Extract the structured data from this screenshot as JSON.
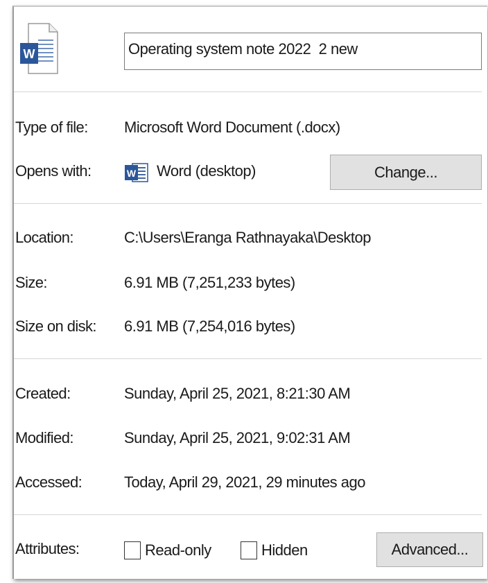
{
  "header": {
    "file_icon": "word-document-icon",
    "file_name": "Operating system note 2022  2 new"
  },
  "type": {
    "label": "Type of file:",
    "value": "Microsoft Word Document (.docx)"
  },
  "opens_with": {
    "label": "Opens with:",
    "app_icon": "word-app-icon",
    "app_name": "Word (desktop)",
    "change_label": "Change..."
  },
  "location": {
    "label": "Location:",
    "value": "C:\\Users\\Eranga Rathnayaka\\Desktop"
  },
  "size": {
    "label": "Size:",
    "value": "6.91 MB (7,251,233 bytes)"
  },
  "size_on_disk": {
    "label": "Size on disk:",
    "value": "6.91 MB (7,254,016 bytes)"
  },
  "created": {
    "label": "Created:",
    "value": "Sunday, April 25, 2021, 8:21:30 AM"
  },
  "modified": {
    "label": "Modified:",
    "value": "Sunday, April 25, 2021, 9:02:31 AM"
  },
  "accessed": {
    "label": "Accessed:",
    "value": "Today, April 29, 2021, 29 minutes ago"
  },
  "attributes": {
    "label": "Attributes:",
    "readonly_label": "Read-only",
    "readonly_checked": false,
    "hidden_label": "Hidden",
    "hidden_checked": false,
    "advanced_label": "Advanced..."
  },
  "colors": {
    "word_blue": "#2b579a",
    "button_face": "#e1e1e1"
  }
}
